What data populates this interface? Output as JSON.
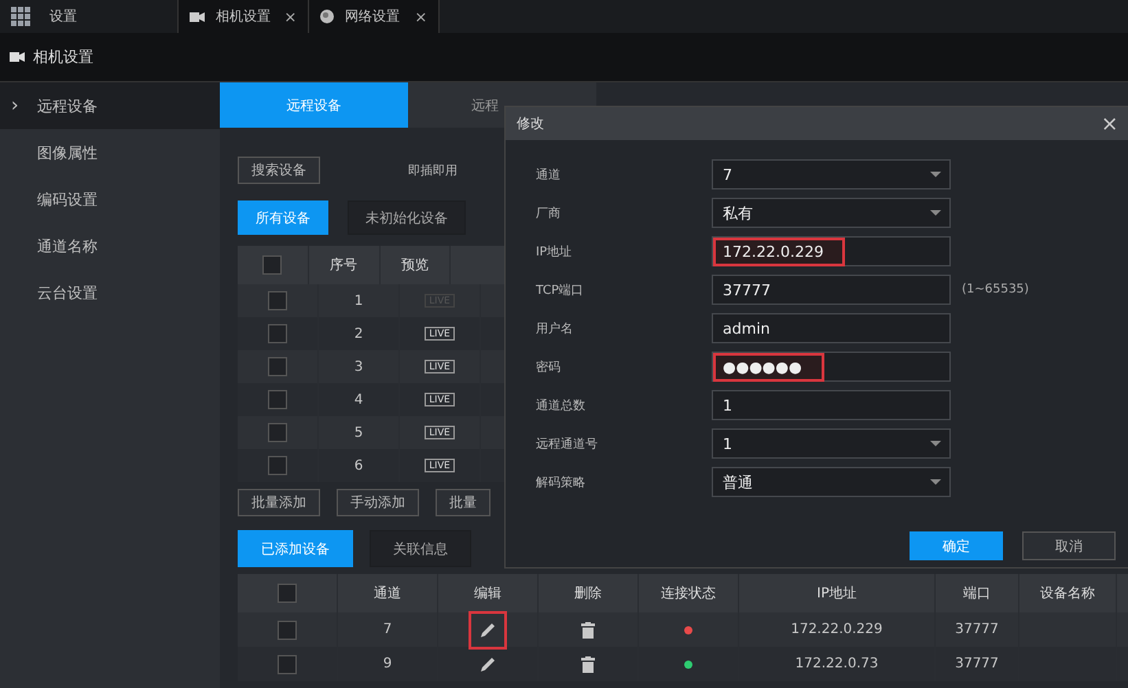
{
  "top_bar": {
    "title": "设置",
    "tabs": [
      {
        "kind": "camera",
        "label": "相机设置",
        "close": "×"
      },
      {
        "kind": "globe",
        "label": "网络设置",
        "close": "×"
      }
    ]
  },
  "header": {
    "title": "相机设置"
  },
  "sidebar": {
    "marker": "›",
    "items": [
      {
        "label": "远程设备",
        "selected": true
      },
      {
        "label": "图像属性",
        "selected": false
      },
      {
        "label": "编码设置",
        "selected": false
      },
      {
        "label": "通道名称",
        "selected": false
      },
      {
        "label": "云台设置",
        "selected": false
      }
    ]
  },
  "content_tabs": [
    {
      "label": "远程设备",
      "selected": true
    },
    {
      "label": "远程",
      "selected": false
    }
  ],
  "search_button": "搜索设备",
  "plug_label": "即插即用",
  "filter_tabs": [
    {
      "label": "所有设备",
      "selected": true
    },
    {
      "label": "未初始化设备",
      "selected": false
    }
  ],
  "device_table": {
    "all_checked": false,
    "columns": [
      "序号",
      "预览"
    ],
    "rows": [
      {
        "checked": false,
        "number": "1",
        "live": "LIVE",
        "disabled": true
      },
      {
        "checked": false,
        "number": "2",
        "live": "LIVE",
        "disabled": false
      },
      {
        "checked": false,
        "number": "3",
        "live": "LIVE",
        "disabled": false
      },
      {
        "checked": false,
        "number": "4",
        "live": "LIVE",
        "disabled": false
      },
      {
        "checked": false,
        "number": "5",
        "live": "LIVE",
        "disabled": false
      },
      {
        "checked": false,
        "number": "6",
        "live": "LIVE",
        "disabled": false
      }
    ]
  },
  "add_buttons": [
    "批量添加",
    "手动添加",
    "批量"
  ],
  "added_tabs": [
    {
      "label": "已添加设备",
      "selected": true
    },
    {
      "label": "关联信息",
      "selected": false
    }
  ],
  "added_table": {
    "all_checked": false,
    "columns": [
      "通道",
      "编辑",
      "删除",
      "连接状态",
      "IP地址",
      "端口",
      "设备名称"
    ],
    "rows": [
      {
        "checked": false,
        "channel": "7",
        "highlighted": true,
        "color": "#e84a4a",
        "ip": "172.22.0.229",
        "port": "37777"
      },
      {
        "checked": false,
        "channel": "9",
        "highlighted": false,
        "color": "#2ecc71",
        "ip": "172.22.0.73",
        "port": "37777"
      }
    ]
  },
  "dialog": {
    "title": "修改",
    "close": "×",
    "fields": [
      {
        "label": "通道",
        "kind": "select",
        "value": "7",
        "highlighted": false
      },
      {
        "label": "厂商",
        "kind": "select",
        "value": "私有",
        "highlighted": false
      },
      {
        "label": "IP地址",
        "kind": "input",
        "value": "172.22.0.229",
        "highlighted": true
      },
      {
        "label": "TCP端口",
        "kind": "input",
        "value": "37777",
        "highlighted": false,
        "hint": "(1~65535)"
      },
      {
        "label": "用户名",
        "kind": "input",
        "value": "admin",
        "highlighted": false
      },
      {
        "label": "密码",
        "kind": "input",
        "value": "●●●●●●",
        "highlighted": true
      },
      {
        "label": "通道总数",
        "kind": "input",
        "value": "1",
        "highlighted": false
      },
      {
        "label": "远程通道号",
        "kind": "select",
        "value": "1",
        "highlighted": false
      },
      {
        "label": "解码策略",
        "kind": "select",
        "value": "普通",
        "highlighted": false
      }
    ],
    "buttons": [
      {
        "label": "确定",
        "kind": "primary"
      },
      {
        "label": "取消",
        "kind": "secondary"
      }
    ]
  }
}
